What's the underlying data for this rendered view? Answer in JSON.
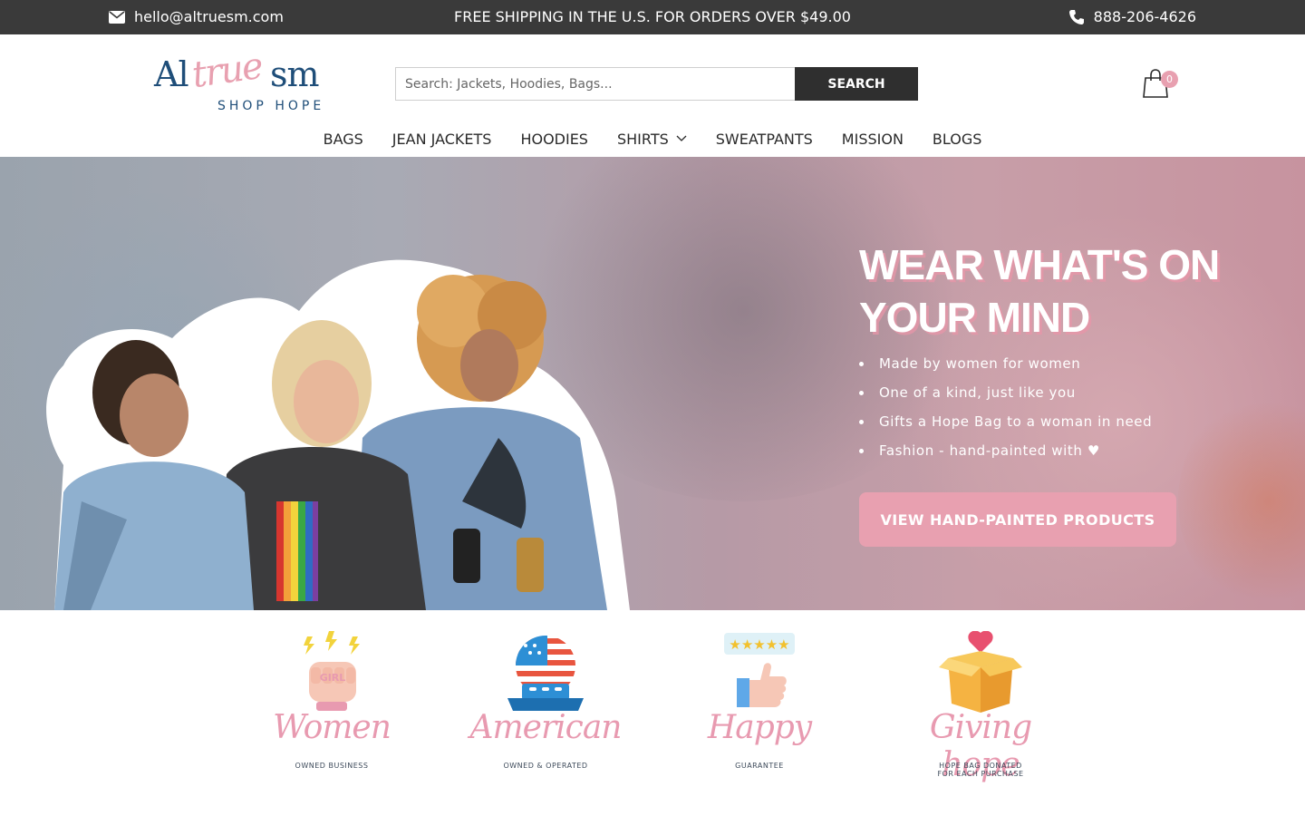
{
  "topbar": {
    "email": "hello@altruesm.com",
    "promo": "FREE SHIPPING IN THE U.S. FOR ORDERS OVER $49.00",
    "phone": "888-206-4626"
  },
  "logo": {
    "word_left": "Al",
    "word_script": "true",
    "word_right": "sm",
    "tagline": "SHOP HOPE"
  },
  "search": {
    "placeholder": "Search: Jackets, Hoodies, Bags...",
    "button_label": "SEARCH"
  },
  "cart": {
    "count": "0"
  },
  "nav": {
    "items": [
      {
        "label": "BAGS"
      },
      {
        "label": "JEAN JACKETS"
      },
      {
        "label": "HOODIES"
      },
      {
        "label": "SHIRTS"
      },
      {
        "label": "SWEATPANTS"
      },
      {
        "label": "MISSION"
      },
      {
        "label": "BLOGS"
      }
    ]
  },
  "hero": {
    "headline": "WEAR WHAT'S ON YOUR MIND",
    "bullets": [
      "Made by women for women",
      "One of a kind, just like you",
      "Gifts a Hope Bag to a woman in need",
      "Fashion - hand-painted with ♥"
    ],
    "cta": "VIEW HAND-PAINTED PRODUCTS"
  },
  "badges": [
    {
      "title": "Women",
      "subtitle": "OWNED BUSINESS"
    },
    {
      "title": "American",
      "subtitle": "OWNED & OPERATED"
    },
    {
      "title": "Happy",
      "subtitle": "GUARANTEE"
    },
    {
      "title": "Giving hope",
      "subtitle": "HOPE BAG DONATED FOR EACH PURCHASE"
    }
  ],
  "colors": {
    "topbar_bg": "#3a3a3a",
    "accent_pink": "#e8a0b0",
    "logo_blue": "#1f4e79",
    "search_button_bg": "#2f2f2f"
  }
}
